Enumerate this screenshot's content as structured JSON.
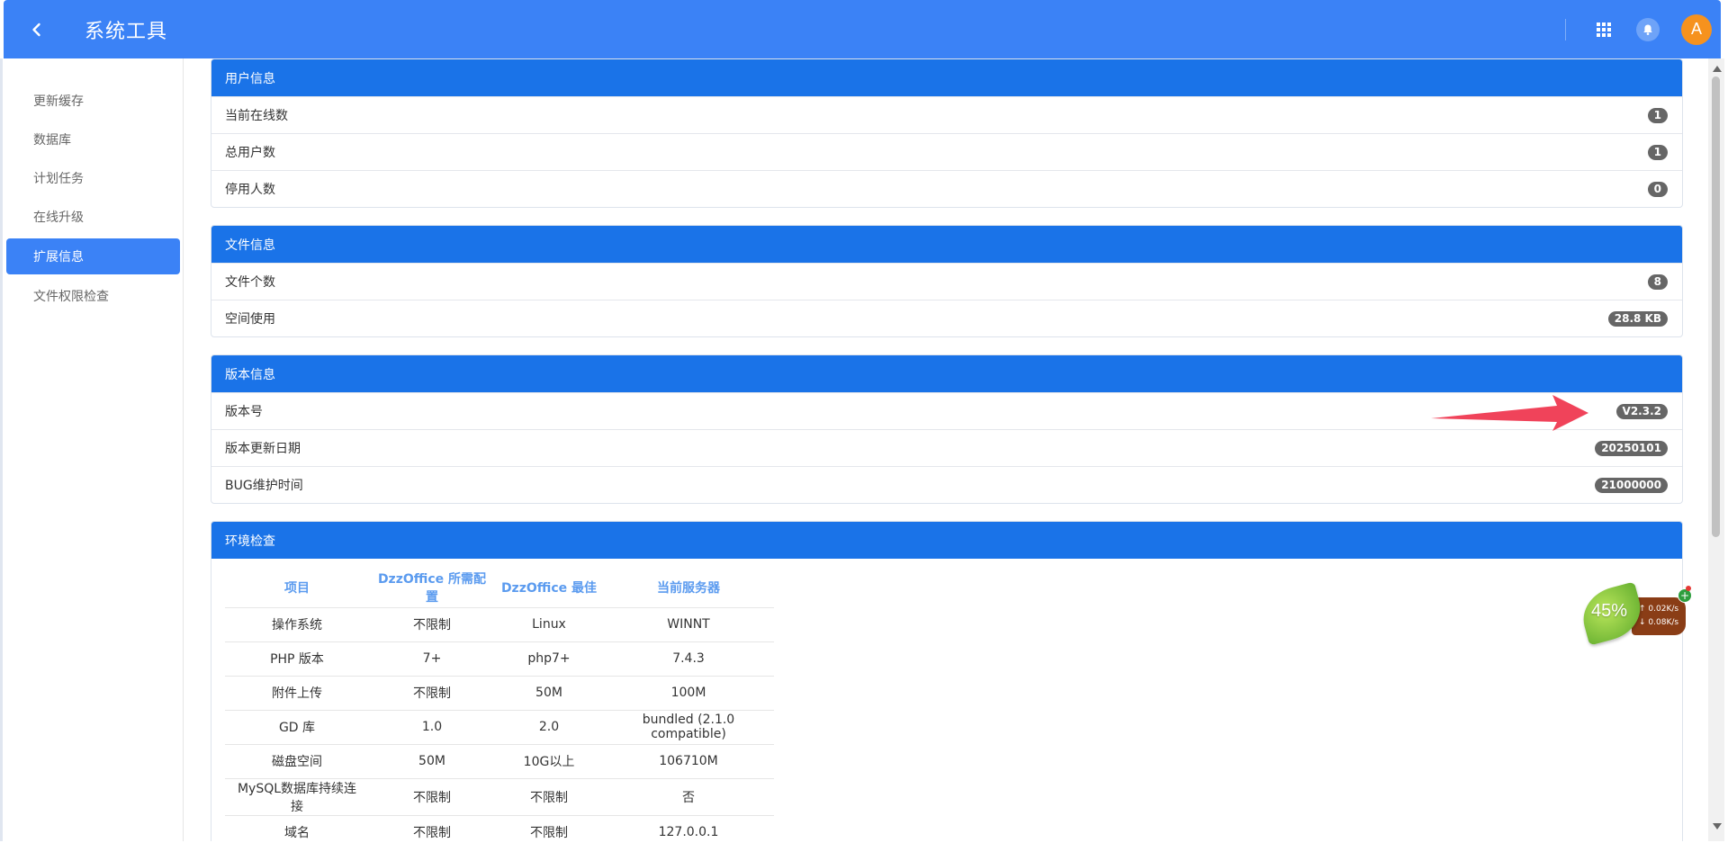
{
  "header": {
    "title": "系统工具",
    "back_icon": "chevron-left-icon",
    "apps_icon": "grid-icon",
    "notify_icon": "bell-icon",
    "avatar_letter": "A",
    "bar_color": "#3b82f6",
    "avatar_color": "#f6921e"
  },
  "sidebar": {
    "items": [
      {
        "label": "更新缓存",
        "active": false
      },
      {
        "label": "数据库",
        "active": false
      },
      {
        "label": "计划任务",
        "active": false
      },
      {
        "label": "在线升级",
        "active": false
      },
      {
        "label": "扩展信息",
        "active": true
      },
      {
        "label": "文件权限检查",
        "active": false
      }
    ]
  },
  "panels": {
    "user": {
      "title": "用户信息",
      "rows": [
        {
          "label": "当前在线数",
          "value": "1"
        },
        {
          "label": "总用户数",
          "value": "1"
        },
        {
          "label": "停用人数",
          "value": "0"
        }
      ]
    },
    "file": {
      "title": "文件信息",
      "rows": [
        {
          "label": "文件个数",
          "value": "8"
        },
        {
          "label": "空间使用",
          "value": "28.8 KB"
        }
      ]
    },
    "version": {
      "title": "版本信息",
      "rows": [
        {
          "label": "版本号",
          "value": "V2.3.2"
        },
        {
          "label": "版本更新日期",
          "value": "20250101"
        },
        {
          "label": "BUG维护时间",
          "value": "21000000"
        }
      ]
    },
    "env": {
      "title": "环境检查",
      "headers": [
        "项目",
        "DzzOffice 所需配置",
        "DzzOffice 最佳",
        "当前服务器"
      ],
      "rows": [
        [
          "操作系统",
          "不限制",
          "Linux",
          "WINNT"
        ],
        [
          "PHP 版本",
          "7+",
          "php7+",
          "7.4.3"
        ],
        [
          "附件上传",
          "不限制",
          "50M",
          "100M"
        ],
        [
          "GD 库",
          "1.0",
          "2.0",
          "bundled (2.1.0 compatible)"
        ],
        [
          "磁盘空间",
          "50M",
          "10G以上",
          "106710M"
        ],
        [
          "MySQL数据库持续连接",
          "不限制",
          "不限制",
          "否"
        ],
        [
          "域名",
          "不限制",
          "不限制",
          "127.0.0.1"
        ]
      ]
    }
  },
  "net_widget": {
    "percent": "45%",
    "upload": "0.02K/s",
    "download": "0.08K/s",
    "plus": "+"
  },
  "annotation": {
    "arrow_color": "#f0435a"
  }
}
